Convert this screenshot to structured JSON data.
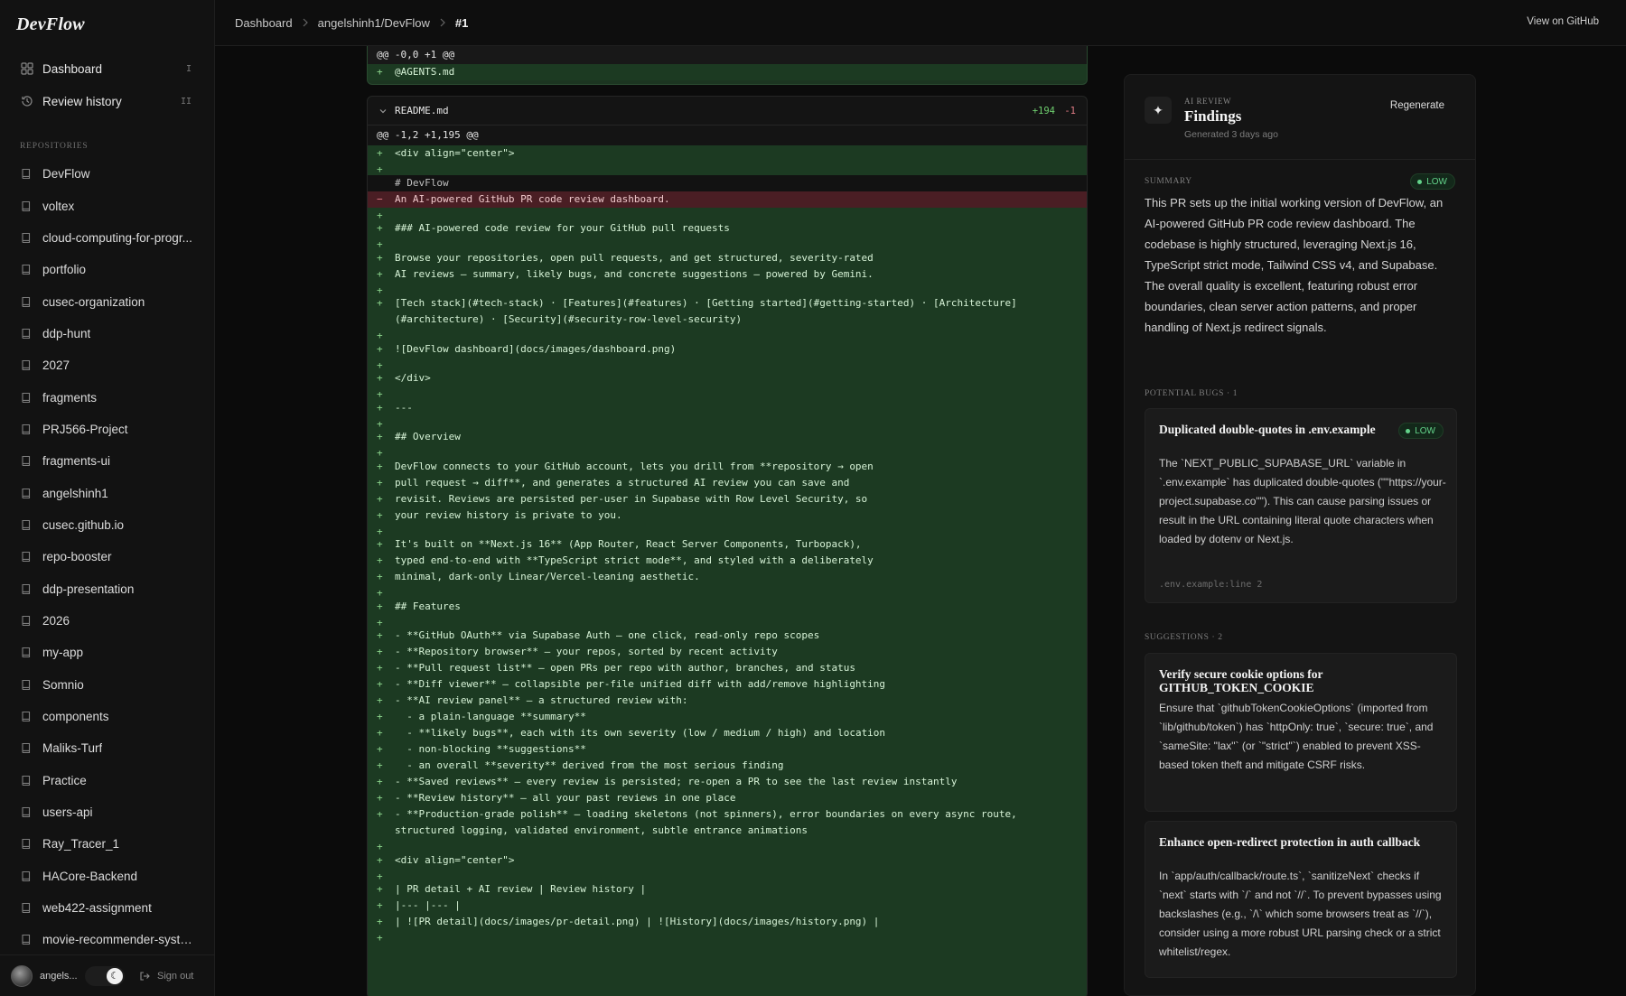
{
  "app": {
    "brand": "DevFlow"
  },
  "nav": [
    {
      "label": "Dashboard",
      "shortcut": "I",
      "icon": "grid-icon"
    },
    {
      "label": "Review history",
      "shortcut": "II",
      "icon": "history-icon"
    }
  ],
  "repositories_label": "Repositories",
  "repositories": [
    "DevFlow",
    "voltex",
    "cloud-computing-for-progr...",
    "portfolio",
    "cusec-organization",
    "ddp-hunt",
    "2027",
    "fragments",
    "PRJ566-Project",
    "fragments-ui",
    "angelshinh1",
    "cusec.github.io",
    "repo-booster",
    "ddp-presentation",
    "2026",
    "my-app",
    "Somnio",
    "components",
    "Maliks-Turf",
    "Practice",
    "users-api",
    "Ray_Tracer_1",
    "HACore-Backend",
    "web422-assignment",
    "movie-recommender-syste..."
  ],
  "user": {
    "name": "angels...",
    "signout": "Sign out"
  },
  "breadcrumb": [
    "Dashboard",
    "angelshinh1/DevFlow",
    "#1"
  ],
  "topbar": {
    "view_github": "View on GitHub"
  },
  "diff_top": {
    "hunk": "@@ -0,0 +1 @@",
    "lines": [
      {
        "t": "add",
        "s": "+",
        "text": "@AGENTS.md"
      }
    ]
  },
  "file": {
    "name": "README.md",
    "additions": "+194",
    "deletions": "-1",
    "hunk": "@@ -1,2 +1,195 @@",
    "lines": [
      {
        "t": "add",
        "s": "+",
        "text": "<div align=\"center\">"
      },
      {
        "t": "add",
        "s": "+",
        "text": ""
      },
      {
        "t": "ctx",
        "s": "",
        "text": "# DevFlow"
      },
      {
        "t": "del",
        "s": "−",
        "text": "An AI-powered GitHub PR code review dashboard."
      },
      {
        "t": "add",
        "s": "+",
        "text": ""
      },
      {
        "t": "add",
        "s": "+",
        "text": "### AI-powered code review for your GitHub pull requests"
      },
      {
        "t": "add",
        "s": "+",
        "text": ""
      },
      {
        "t": "add",
        "s": "+",
        "text": "Browse your repositories, open pull requests, and get structured, severity-rated"
      },
      {
        "t": "add",
        "s": "+",
        "text": "AI reviews — summary, likely bugs, and concrete suggestions — powered by Gemini."
      },
      {
        "t": "add",
        "s": "+",
        "text": ""
      },
      {
        "t": "add",
        "s": "+",
        "text": "[Tech stack](#tech-stack) · [Features](#features) · [Getting started](#getting-started) · [Architecture](#architecture) · [Security](#security-row-level-security)"
      },
      {
        "t": "add",
        "s": "+",
        "text": ""
      },
      {
        "t": "add",
        "s": "+",
        "text": "![DevFlow dashboard](docs/images/dashboard.png)"
      },
      {
        "t": "add",
        "s": "+",
        "text": ""
      },
      {
        "t": "add",
        "s": "+",
        "text": "</div>"
      },
      {
        "t": "add",
        "s": "+",
        "text": ""
      },
      {
        "t": "add",
        "s": "+",
        "text": "---"
      },
      {
        "t": "add",
        "s": "+",
        "text": ""
      },
      {
        "t": "add",
        "s": "+",
        "text": "## Overview"
      },
      {
        "t": "add",
        "s": "+",
        "text": ""
      },
      {
        "t": "add",
        "s": "+",
        "text": "DevFlow connects to your GitHub account, lets you drill from **repository → open"
      },
      {
        "t": "add",
        "s": "+",
        "text": "pull request → diff**, and generates a structured AI review you can save and"
      },
      {
        "t": "add",
        "s": "+",
        "text": "revisit. Reviews are persisted per-user in Supabase with Row Level Security, so"
      },
      {
        "t": "add",
        "s": "+",
        "text": "your review history is private to you."
      },
      {
        "t": "add",
        "s": "+",
        "text": ""
      },
      {
        "t": "add",
        "s": "+",
        "text": "It's built on **Next.js 16** (App Router, React Server Components, Turbopack),"
      },
      {
        "t": "add",
        "s": "+",
        "text": "typed end-to-end with **TypeScript strict mode**, and styled with a deliberately"
      },
      {
        "t": "add",
        "s": "+",
        "text": "minimal, dark-only Linear/Vercel-leaning aesthetic."
      },
      {
        "t": "add",
        "s": "+",
        "text": ""
      },
      {
        "t": "add",
        "s": "+",
        "text": "## Features"
      },
      {
        "t": "add",
        "s": "+",
        "text": ""
      },
      {
        "t": "add",
        "s": "+",
        "text": "- **GitHub OAuth** via Supabase Auth — one click, read-only repo scopes"
      },
      {
        "t": "add",
        "s": "+",
        "text": "- **Repository browser** — your repos, sorted by recent activity"
      },
      {
        "t": "add",
        "s": "+",
        "text": "- **Pull request list** — open PRs per repo with author, branches, and status"
      },
      {
        "t": "add",
        "s": "+",
        "text": "- **Diff viewer** — collapsible per-file unified diff with add/remove highlighting"
      },
      {
        "t": "add",
        "s": "+",
        "text": "- **AI review panel** — a structured review with:"
      },
      {
        "t": "add",
        "s": "+",
        "text": "  - a plain-language **summary**"
      },
      {
        "t": "add",
        "s": "+",
        "text": "  - **likely bugs**, each with its own severity (low / medium / high) and location"
      },
      {
        "t": "add",
        "s": "+",
        "text": "  - non-blocking **suggestions**"
      },
      {
        "t": "add",
        "s": "+",
        "text": "  - an overall **severity** derived from the most serious finding"
      },
      {
        "t": "add",
        "s": "+",
        "text": "- **Saved reviews** — every review is persisted; re-open a PR to see the last review instantly"
      },
      {
        "t": "add",
        "s": "+",
        "text": "- **Review history** — all your past reviews in one place"
      },
      {
        "t": "add",
        "s": "+",
        "text": "- **Production-grade polish** — loading skeletons (not spinners), error boundaries on every async route, structured logging, validated environment, subtle entrance animations"
      },
      {
        "t": "add",
        "s": "+",
        "text": ""
      },
      {
        "t": "add",
        "s": "+",
        "text": "<div align=\"center\">"
      },
      {
        "t": "add",
        "s": "+",
        "text": ""
      },
      {
        "t": "add",
        "s": "+",
        "text": "| PR detail + AI review | Review history |"
      },
      {
        "t": "add",
        "s": "+",
        "text": "|--- |--- |"
      },
      {
        "t": "add",
        "s": "+",
        "text": "| ![PR detail](docs/images/pr-detail.png) | ![History](docs/images/history.png) |"
      },
      {
        "t": "add",
        "s": "+",
        "text": ""
      }
    ]
  },
  "review": {
    "label": "AI Review",
    "title": "Findings",
    "generated": "Generated 3 days ago",
    "regenerate": "Regenerate",
    "summary_label": "Summary",
    "overall_severity": "LOW",
    "summary": "This PR sets up the initial working version of DevFlow, an AI-powered GitHub PR code review dashboard. The codebase is highly structured, leveraging Next.js 16, TypeScript strict mode, Tailwind CSS v4, and Supabase. The overall quality is excellent, featuring robust error boundaries, clean server action patterns, and proper handling of Next.js redirect signals.",
    "bugs_label": "Potential bugs · 1",
    "bugs": [
      {
        "title": "Duplicated double-quotes in .env.example",
        "severity": "LOW",
        "body": "The `NEXT_PUBLIC_SUPABASE_URL` variable in `.env.example` has duplicated double-quotes (\"\"https://your-project.supabase.co\"\"). This can cause parsing issues or result in the URL containing literal quote characters when loaded by dotenv or Next.js.",
        "location": ".env.example:line 2"
      }
    ],
    "suggestions_label": "Suggestions · 2",
    "suggestions": [
      {
        "title": "Verify secure cookie options for GITHUB_TOKEN_COOKIE",
        "body": "Ensure that `githubTokenCookieOptions` (imported from `lib/github/token`) has `httpOnly: true`, `secure: true`, and `sameSite: \"lax\"` (or `\"strict\"`) enabled to prevent XSS-based token theft and mitigate CSRF risks."
      },
      {
        "title": "Enhance open-redirect protection in auth callback",
        "body": "In `app/auth/callback/route.ts`, `sanitizeNext` checks if `next` starts with `/` and not `//`. To prevent bypasses using backslashes (e.g., `/\\` which some browsers treat as `//`), consider using a more robust URL parsing check or a strict whitelist/regex."
      }
    ]
  },
  "colors": {
    "accent_green": "#63d38a",
    "diff_add_bg": "#1c3a22",
    "diff_del_bg": "#4a1e24"
  }
}
